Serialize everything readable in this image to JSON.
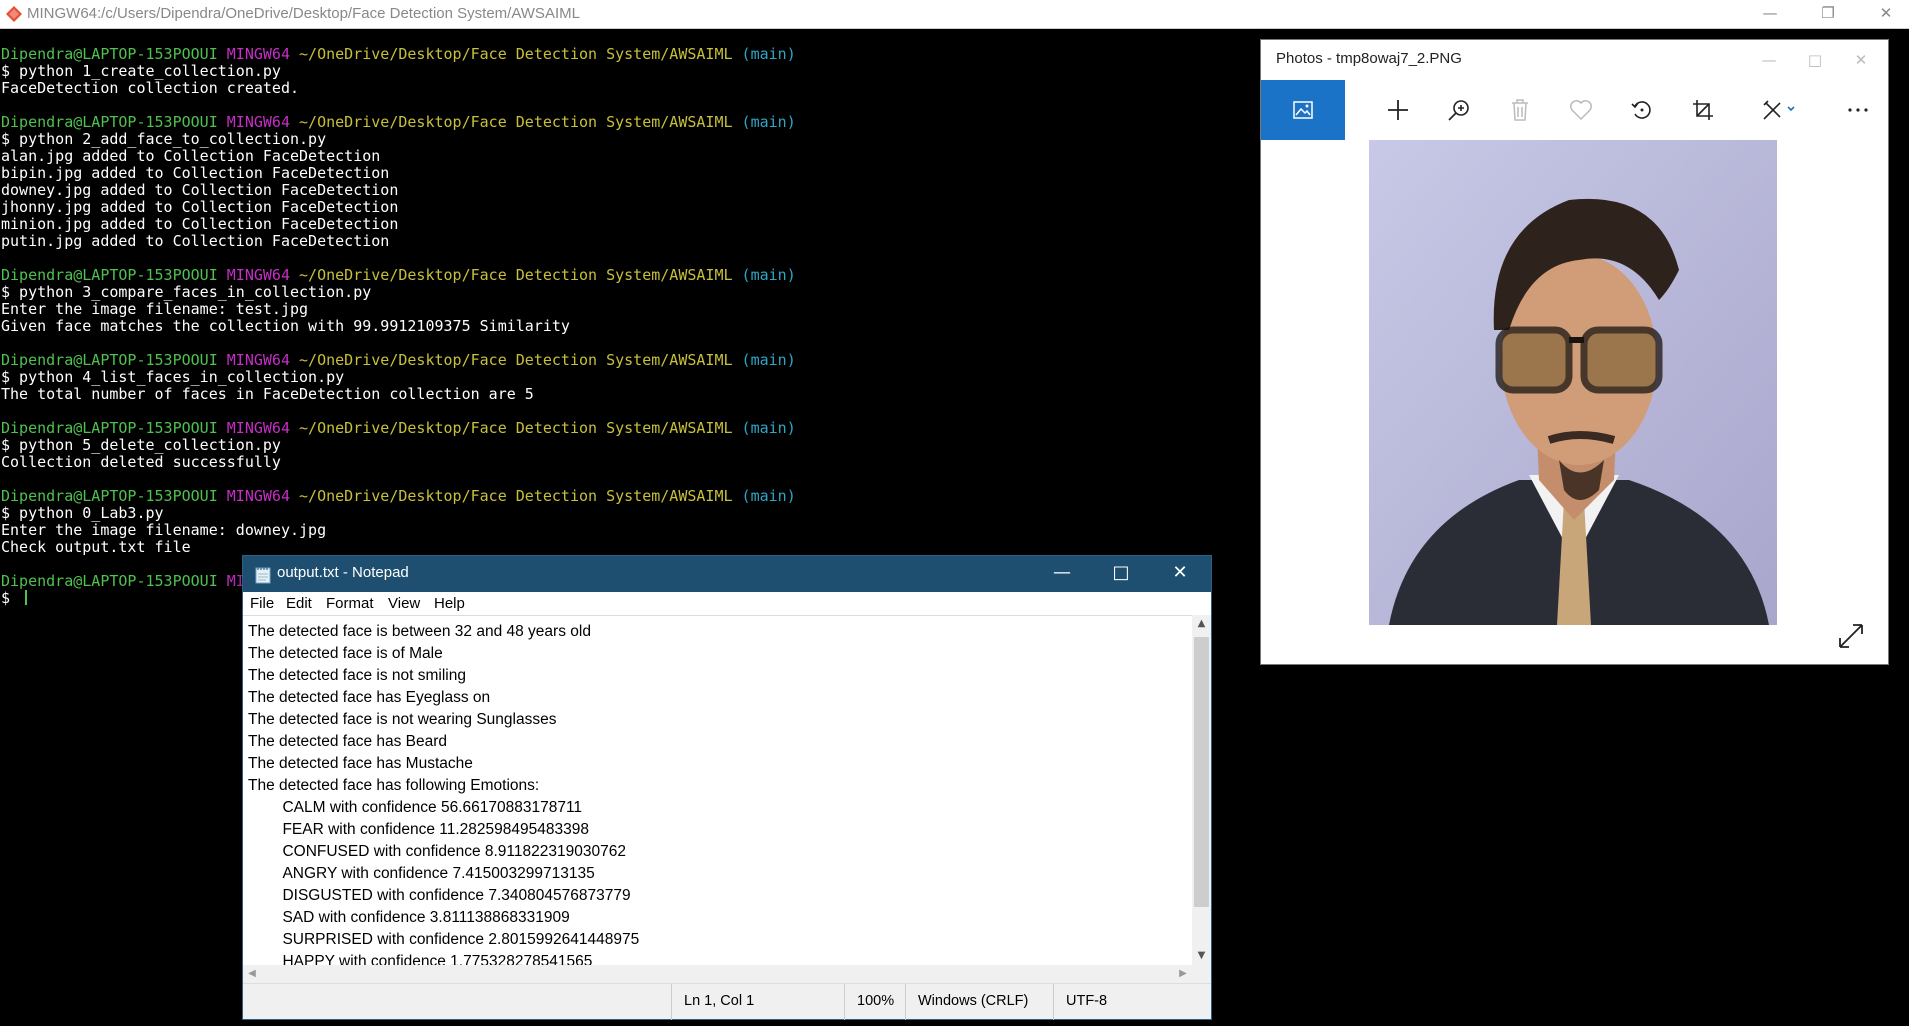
{
  "terminal": {
    "title": "MINGW64:/c/Users/Dipendra/OneDrive/Desktop/Face Detection System/AWSAIML",
    "prompt_user": "Dipendra@LAPTOP-153POOUI",
    "prompt_shell": "MINGW64",
    "prompt_path": "~/OneDrive/Desktop/Face Detection System/AWSAIML",
    "prompt_branch": "(main)",
    "blocks": [
      {
        "command": "$ python 1_create_collection.py",
        "output": [
          "FaceDetection collection created."
        ]
      },
      {
        "command": "$ python 2_add_face_to_collection.py",
        "output": [
          "alan.jpg added to Collection FaceDetection",
          "bipin.jpg added to Collection FaceDetection",
          "downey.jpg added to Collection FaceDetection",
          "jhonny.jpg added to Collection FaceDetection",
          "minion.jpg added to Collection FaceDetection",
          "putin.jpg added to Collection FaceDetection"
        ]
      },
      {
        "command": "$ python 3_compare_faces_in_collection.py",
        "output": [
          "Enter the image filename: test.jpg",
          "Given face matches the collection with 99.9912109375 Similarity"
        ]
      },
      {
        "command": "$ python 4_list_faces_in_collection.py",
        "output": [
          "The total number of faces in FaceDetection collection are 5"
        ]
      },
      {
        "command": "$ python 5_delete_collection.py",
        "output": [
          "Collection deleted successfully"
        ]
      },
      {
        "command": "$ python 0_Lab3.py",
        "output": [
          "Enter the image filename: downey.jpg",
          "Check output.txt file"
        ]
      }
    ],
    "current_prompt": "$ "
  },
  "photos": {
    "title": "Photos - tmp8owaj7_2.PNG",
    "toolbar_icons": [
      "see-all-photos-icon",
      "add-icon",
      "zoom-icon",
      "delete-icon",
      "favorite-icon",
      "rotate-icon",
      "crop-icon",
      "edit-icon",
      "more-icon"
    ]
  },
  "notepad": {
    "title": "output.txt - Notepad",
    "menu": [
      "File",
      "Edit",
      "Format",
      "View",
      "Help"
    ],
    "lines": [
      "The detected face is between 32 and 48 years old",
      "The detected face is of Male",
      "The detected face is not smiling",
      "The detected face has Eyeglass on",
      "The detected face is not wearing Sunglasses",
      "The detected face has Beard",
      "The detected face has Mustache",
      "The detected face has following Emotions:",
      "\t\tCALM with confidence 56.66170883178711",
      "\t\tFEAR with confidence 11.282598495483398",
      "\t\tCONFUSED with confidence 8.911822319030762",
      "\t\tANGRY with confidence 7.415003299713135",
      "\t\tDISGUSTED with confidence 7.340804576873779",
      "\t\tSAD with confidence 3.811138868331909",
      "\t\tSURPRISED with confidence 2.8015992641448975",
      "\t\tHAPPY with confidence 1.775328278541565"
    ],
    "status": {
      "position": "Ln 1, Col 1",
      "zoom": "100%",
      "line_ending": "Windows (CRLF)",
      "encoding": "UTF-8"
    }
  }
}
